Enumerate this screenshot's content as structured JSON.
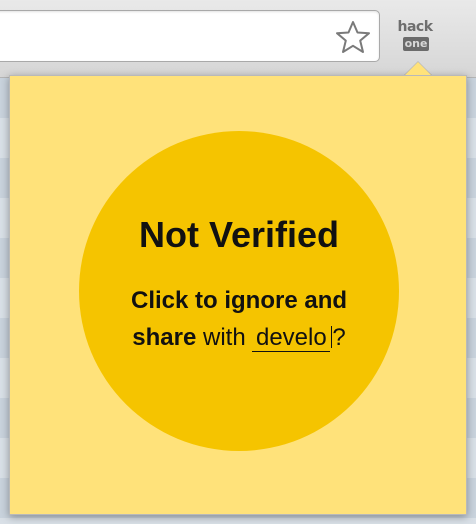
{
  "toolbar": {
    "bookmark_icon": "star-icon",
    "extension": {
      "label_top": "hack",
      "label_bottom": "one"
    }
  },
  "popup": {
    "status_title": "Not Verified",
    "action_bold": "Click to ignore and share",
    "action_with": "with",
    "recipient_value": "develo",
    "question_mark": "?",
    "colors": {
      "background": "#ffe27a",
      "circle": "#f5c400",
      "text": "#111111"
    }
  }
}
